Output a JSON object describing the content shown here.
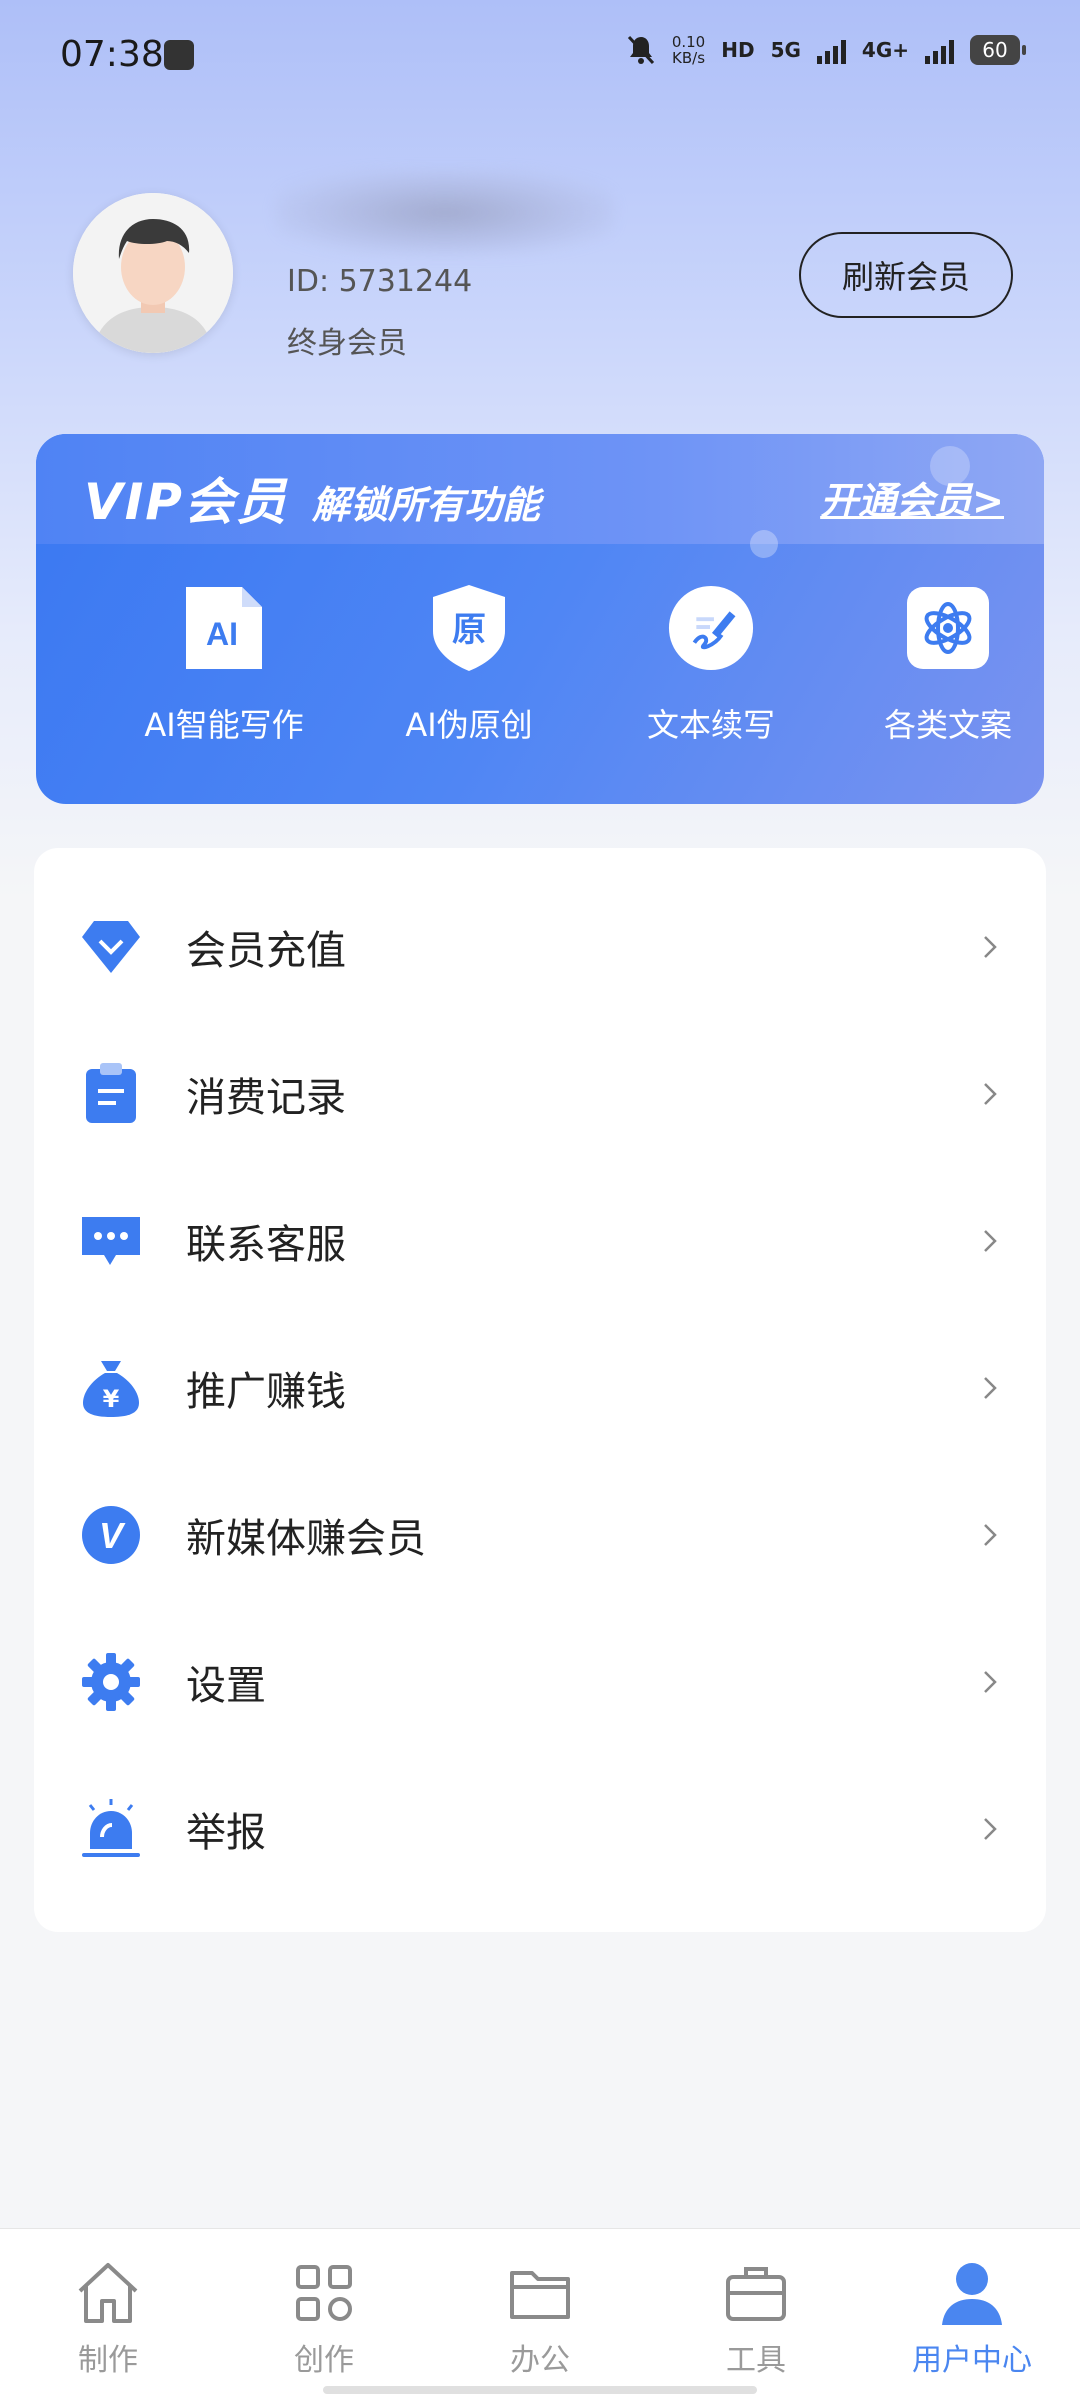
{
  "status_bar": {
    "time": "07:38",
    "speed_top": "0.10",
    "speed_bottom": "KB/s",
    "hd": "HD",
    "net1": "5G",
    "net2": "4G+",
    "battery": "60"
  },
  "profile": {
    "user_id": "ID: 5731244",
    "member_type": "终身会员",
    "refresh_label": "刷新会员"
  },
  "vip_card": {
    "title": "VIP会员",
    "subtitle": "解锁所有功能",
    "open_label": "开通会员>",
    "items": [
      {
        "label": "AI智能写作",
        "icon": "ai-doc-icon",
        "glyph": "AI"
      },
      {
        "label": "AI伪原创",
        "icon": "original-badge-icon",
        "glyph": "原"
      },
      {
        "label": "文本续写",
        "icon": "pen-write-icon"
      },
      {
        "label": "各类文案",
        "icon": "atom-icon"
      }
    ]
  },
  "menu": {
    "items": [
      {
        "label": "会员充值",
        "icon": "diamond-icon"
      },
      {
        "label": "消费记录",
        "icon": "clipboard-icon"
      },
      {
        "label": "联系客服",
        "icon": "chat-bubble-icon"
      },
      {
        "label": "推广赚钱",
        "icon": "money-bag-icon",
        "glyph": "¥"
      },
      {
        "label": "新媒体赚会员",
        "icon": "v-circle-icon",
        "glyph": "V"
      },
      {
        "label": "设置",
        "icon": "gear-icon"
      },
      {
        "label": "举报",
        "icon": "alarm-light-icon"
      }
    ]
  },
  "bottom_nav": {
    "items": [
      {
        "label": "制作",
        "icon": "home-icon"
      },
      {
        "label": "创作",
        "icon": "grid-icon"
      },
      {
        "label": "办公",
        "icon": "folder-icon"
      },
      {
        "label": "工具",
        "icon": "briefcase-icon"
      },
      {
        "label": "用户中心",
        "icon": "user-icon"
      }
    ],
    "active_index": 4
  },
  "colors": {
    "accent": "#4a86f0",
    "vip_card": "#3a78f2",
    "icon_blue": "#3d7cf0"
  }
}
